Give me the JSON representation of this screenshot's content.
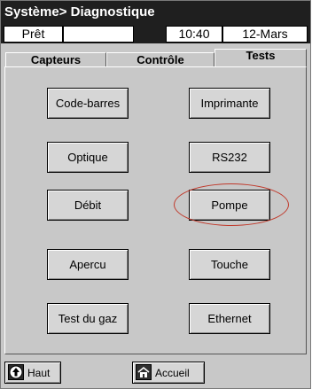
{
  "title": "Système> Diagnostique",
  "status": {
    "state": "Prêt",
    "empty": "",
    "time": "10:40",
    "date": "12-Mars"
  },
  "tabs": [
    {
      "label": "Capteurs"
    },
    {
      "label": "Contrôle"
    },
    {
      "label": "Tests"
    }
  ],
  "buttons": [
    {
      "label": "Code-barres"
    },
    {
      "label": "Imprimante"
    },
    {
      "label": "Optique"
    },
    {
      "label": "RS232"
    },
    {
      "label": "Débit"
    },
    {
      "label": "Pompe"
    },
    {
      "label": "Apercu"
    },
    {
      "label": "Touche"
    },
    {
      "label": "Test du gaz"
    },
    {
      "label": "Ethernet"
    }
  ],
  "footer": {
    "up_label": "Haut",
    "home_label": "Accueil"
  },
  "colors": {
    "titlebar": "#1f1f1f",
    "panel": "#c8c8c8",
    "highlight_oval": "#c0392b"
  },
  "icons": {
    "up": "arrow-up-icon",
    "home": "home-icon"
  }
}
